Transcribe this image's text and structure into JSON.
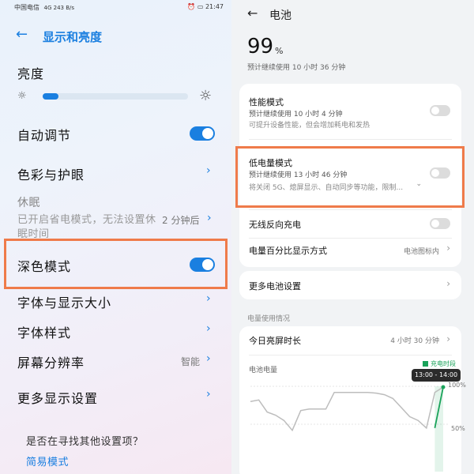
{
  "left": {
    "status_bar": {
      "carrier": "中国电信",
      "signal": "4G 243 B/s",
      "time": "21:47"
    },
    "header": {
      "title": "显示和亮度"
    },
    "brightness": {
      "label": "亮度",
      "level_percent": 11
    },
    "auto_adjust": {
      "label": "自动调节",
      "on": true
    },
    "color": {
      "label": "色彩与护眼"
    },
    "sleep": {
      "label": "休眠",
      "value": "2 分钟后",
      "note": "已开启省电模式，无法设置休眠时间"
    },
    "dark_mode": {
      "label": "深色模式",
      "on": true
    },
    "font_size": {
      "label": "字体与显示大小"
    },
    "font_style": {
      "label": "字体样式"
    },
    "resolution": {
      "label": "屏幕分辨率",
      "value": "智能"
    },
    "more_display": {
      "label": "更多显示设置"
    },
    "footer": {
      "question": "是否在寻找其他设置项？",
      "link": "简易模式"
    }
  },
  "right": {
    "header": {
      "title": "电池"
    },
    "battery": {
      "percent": "99",
      "unit": "%",
      "estimate": "预计继续使用 10 小时 36 分钟"
    },
    "performance": {
      "title": "性能模式",
      "estimate": "预计继续使用 10 小时 4 分钟",
      "desc": "可提升设备性能，但会增加耗电和发热",
      "on": false
    },
    "low_power": {
      "title": "低电量模式",
      "estimate": "预计继续使用 13 小时 46 分钟",
      "desc": "将关闭 5G、熄屏显示、自动同步等功能，限制...",
      "on": false
    },
    "wireless_reverse": {
      "title": "无线反向充电",
      "on": false
    },
    "pct_display": {
      "title": "电量百分比显示方式",
      "value": "电池图标内"
    },
    "more_battery": {
      "title": "更多电池设置"
    },
    "usage": {
      "section_title": "电量使用情况",
      "screen_on_label": "今日亮屏时长",
      "screen_on_value": "4 小时 30 分钟",
      "chart_title": "电池电量",
      "legend_charging": "充电时段",
      "tooltip": "13:00 - 14:00",
      "tick_100": "100%",
      "tick_50": "50%"
    }
  },
  "colors": {
    "accent": "#1a7fe0",
    "highlight": "#ef7b4a",
    "charge_green": "#1aa35a"
  },
  "chart_data": {
    "type": "line",
    "title": "电池电量",
    "ylim": [
      0,
      100
    ],
    "y_ticks": [
      "100%",
      "50%"
    ],
    "legend": [
      "充电时段"
    ],
    "tooltip": "13:00 - 14:00",
    "series": [
      {
        "name": "",
        "values": [
          80,
          82,
          66,
          62,
          55,
          42,
          68,
          70,
          70,
          70,
          92,
          92,
          92,
          92,
          92,
          91,
          89,
          84,
          72,
          60,
          55,
          45,
          92,
          99
        ]
      },
      {
        "name": "充电时段",
        "values": [
          null,
          null,
          null,
          null,
          null,
          null,
          null,
          null,
          null,
          null,
          null,
          null,
          null,
          null,
          null,
          null,
          null,
          null,
          null,
          null,
          null,
          null,
          45,
          99
        ]
      }
    ]
  }
}
